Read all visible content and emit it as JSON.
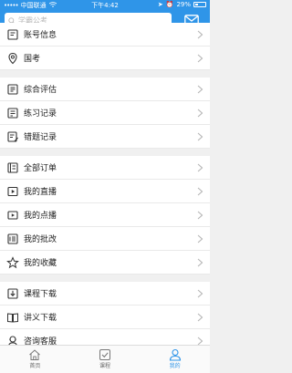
{
  "status": {
    "carrier": "中国联通",
    "time": "下午4:42",
    "battery": "29%",
    "battery_level": 0.29
  },
  "search": {
    "placeholder": "学霸公考"
  },
  "menu_groups": [
    [
      {
        "label": "账号信息",
        "icon": "account-info-icon"
      },
      {
        "label": "国考",
        "icon": "location-pin-icon"
      }
    ],
    [
      {
        "label": "综合评估",
        "icon": "assessment-icon"
      },
      {
        "label": "练习记录",
        "icon": "practice-record-icon"
      },
      {
        "label": "错题记录",
        "icon": "wrong-questions-icon"
      }
    ],
    [
      {
        "label": "全部订单",
        "icon": "orders-icon"
      },
      {
        "label": "我的直播",
        "icon": "live-icon"
      },
      {
        "label": "我的点播",
        "icon": "video-on-demand-icon"
      },
      {
        "label": "我的批改",
        "icon": "grading-icon"
      },
      {
        "label": "我的收藏",
        "icon": "star-icon"
      }
    ],
    [
      {
        "label": "课程下载",
        "icon": "course-download-icon"
      },
      {
        "label": "讲义下载",
        "icon": "handout-download-icon"
      },
      {
        "label": "咨询客服",
        "icon": "customer-service-icon"
      }
    ]
  ],
  "tabs": [
    {
      "label": "首页",
      "icon": "home-icon"
    },
    {
      "label": "课程",
      "icon": "course-icon"
    },
    {
      "label": "我的",
      "icon": "profile-icon"
    }
  ],
  "colors": {
    "accent": "#2f95e8"
  }
}
